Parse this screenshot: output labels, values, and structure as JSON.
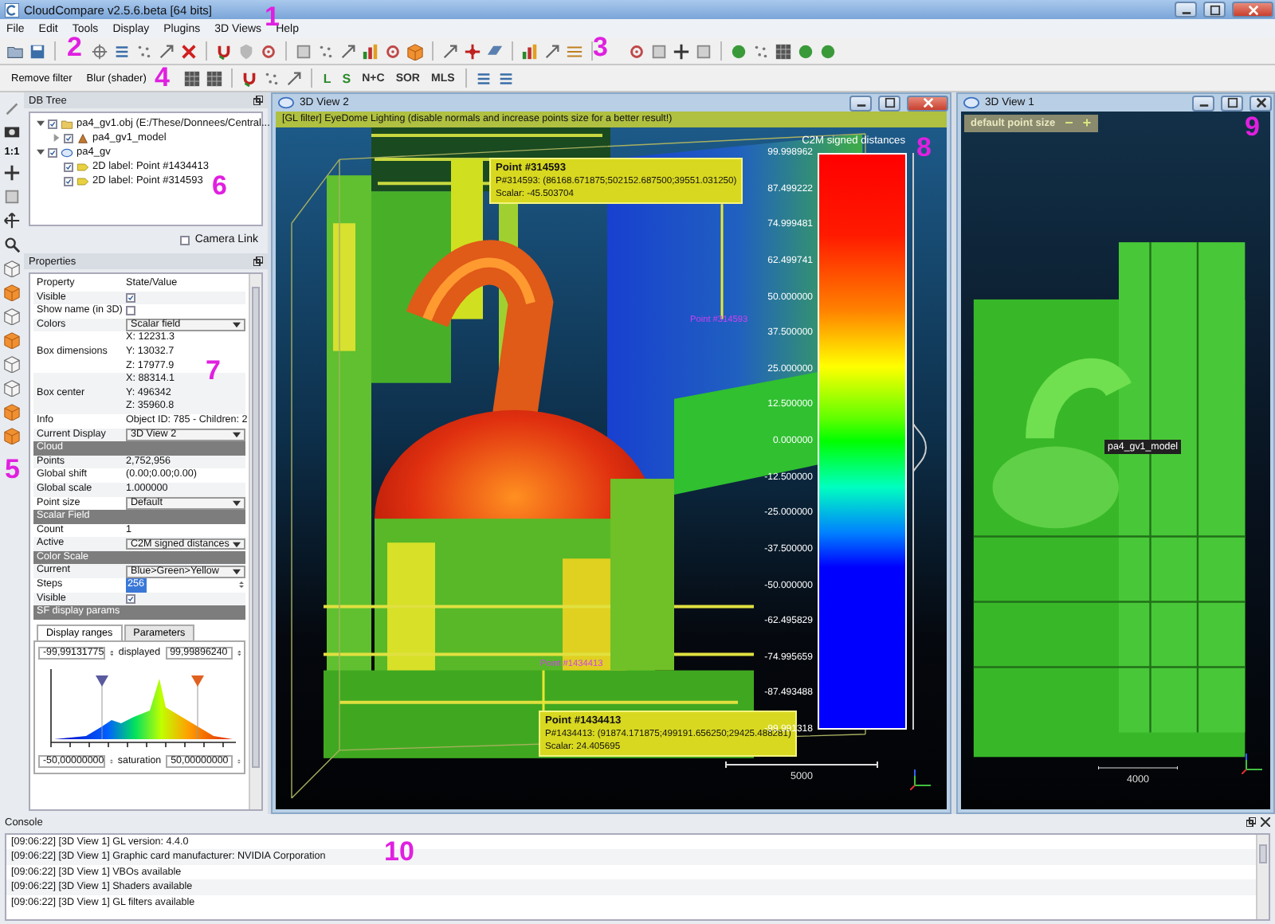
{
  "window": {
    "title": "CloudCompare v2.5.6.beta [64 bits]"
  },
  "menu": [
    "File",
    "Edit",
    "Tools",
    "Display",
    "Plugins",
    "3D Views",
    "Help"
  ],
  "filter_toolbar": {
    "buttons": [
      "Remove filter",
      "Blur (shader)"
    ]
  },
  "tool_labels": [
    "L",
    "S",
    "N+C",
    "SOR",
    "MLS"
  ],
  "view_strip": {
    "zoom_label": "1:1"
  },
  "db_tree": {
    "title": "DB Tree",
    "items": [
      {
        "label": "pa4_gv1.obj (E:/These/Donnees/Central...",
        "kind": "file",
        "checked": true,
        "expanded": true,
        "children": [
          {
            "label": "pa4_gv1_model",
            "kind": "mesh",
            "checked": true,
            "expanded": false
          }
        ]
      },
      {
        "label": "pa4_gv",
        "kind": "cloud",
        "checked": true,
        "expanded": true,
        "children": [
          {
            "label": "2D label: Point #1434413",
            "kind": "label",
            "checked": true
          },
          {
            "label": "2D label: Point #314593",
            "kind": "label",
            "checked": true
          }
        ]
      }
    ],
    "camera_link": {
      "label": "Camera Link",
      "checked": false
    }
  },
  "properties": {
    "title": "Properties",
    "rows": [
      {
        "kind": "header",
        "name": "Property",
        "value": "State/Value"
      },
      {
        "kind": "check",
        "name": "Visible",
        "checked": true
      },
      {
        "kind": "check",
        "name": "Show name (in 3D)",
        "checked": false
      },
      {
        "kind": "combo",
        "name": "Colors",
        "value": "Scalar field"
      },
      {
        "kind": "multi",
        "name": "Box dimensions",
        "lines": [
          "X: 12231.3",
          "Y: 13032.7",
          "Z: 17977.9"
        ]
      },
      {
        "kind": "multi",
        "name": "Box center",
        "lines": [
          "X: 88314.1",
          "Y: 496342",
          "Z: 35960.8"
        ]
      },
      {
        "kind": "text",
        "name": "Info",
        "value": "Object ID: 785 - Children: 2"
      },
      {
        "kind": "combo",
        "name": "Current Display",
        "value": "3D View 2"
      },
      {
        "kind": "section",
        "name": "Cloud"
      },
      {
        "kind": "text",
        "name": "Points",
        "value": "2,752,956"
      },
      {
        "kind": "text",
        "name": "Global shift",
        "value": "(0.00;0.00;0.00)"
      },
      {
        "kind": "text",
        "name": "Global scale",
        "value": "1.000000"
      },
      {
        "kind": "combo",
        "name": "Point size",
        "value": "Default"
      },
      {
        "kind": "section",
        "name": "Scalar Field"
      },
      {
        "kind": "text",
        "name": "Count",
        "value": "1"
      },
      {
        "kind": "combo",
        "name": "Active",
        "value": "C2M signed distances"
      },
      {
        "kind": "section",
        "name": "Color Scale"
      },
      {
        "kind": "combo",
        "name": "Current",
        "value": "Blue>Green>Yellow"
      },
      {
        "kind": "spin",
        "name": "Steps",
        "value": "256"
      },
      {
        "kind": "check",
        "name": "Visible",
        "checked": true
      },
      {
        "kind": "section",
        "name": "SF display params"
      }
    ],
    "sf_tabs": [
      {
        "label": "Display ranges",
        "selected": true
      },
      {
        "label": "Parameters",
        "selected": false
      }
    ],
    "display_range": {
      "min": "-99,99131775",
      "label": "displayed",
      "max": "99,99896240"
    },
    "saturation": {
      "min": "-50,00000000",
      "label": "saturation",
      "max": "50,00000000"
    }
  },
  "view2": {
    "title": "3D View 2",
    "banner": "[GL filter] EyeDome Lighting (disable normals and increase points size for a better result!)",
    "color_scale": {
      "title": "C2M signed distances",
      "ticks": [
        "99.998962",
        "87.499222",
        "74.999481",
        "62.499741",
        "50.000000",
        "37.500000",
        "25.000000",
        "12.500000",
        "0.000000",
        "-12.500000",
        "-25.000000",
        "-37.500000",
        "-50.000000",
        "-62.495829",
        "-74.995659",
        "-87.493488",
        "-99.991318"
      ]
    },
    "point_labels": [
      {
        "title": "Point #314593",
        "lines": [
          "P#314593: (86168.671875;502152.687500;39551.031250)",
          "Scalar: -45.503704"
        ]
      },
      {
        "title": "Point #1434413",
        "lines": [
          "P#1434413: (91874.171875;499191.656250;29425.488281)",
          "Scalar: 24.405695"
        ]
      }
    ],
    "scene_labels": [
      "Point #314593",
      "Point #1434413"
    ],
    "scale_bar": "5000"
  },
  "view1": {
    "title": "3D View 1",
    "point_size": {
      "label": "default point size",
      "decrease": "−",
      "increase": "+"
    },
    "object_label": "pa4_gv1_model",
    "scale_bar": "4000"
  },
  "console": {
    "title": "Console",
    "lines": [
      "[09:06:22] [3D View 1] GL version: 4.4.0",
      "[09:06:22] [3D View 1] Graphic card manufacturer: NVIDIA Corporation",
      "[09:06:22] [3D View 1] VBOs available",
      "[09:06:22] [3D View 1] Shaders available",
      "[09:06:22] [3D View 1] GL filters available"
    ]
  },
  "annotations": [
    "1",
    "2",
    "3",
    "4",
    "5",
    "6",
    "7",
    "8",
    "9",
    "10"
  ]
}
